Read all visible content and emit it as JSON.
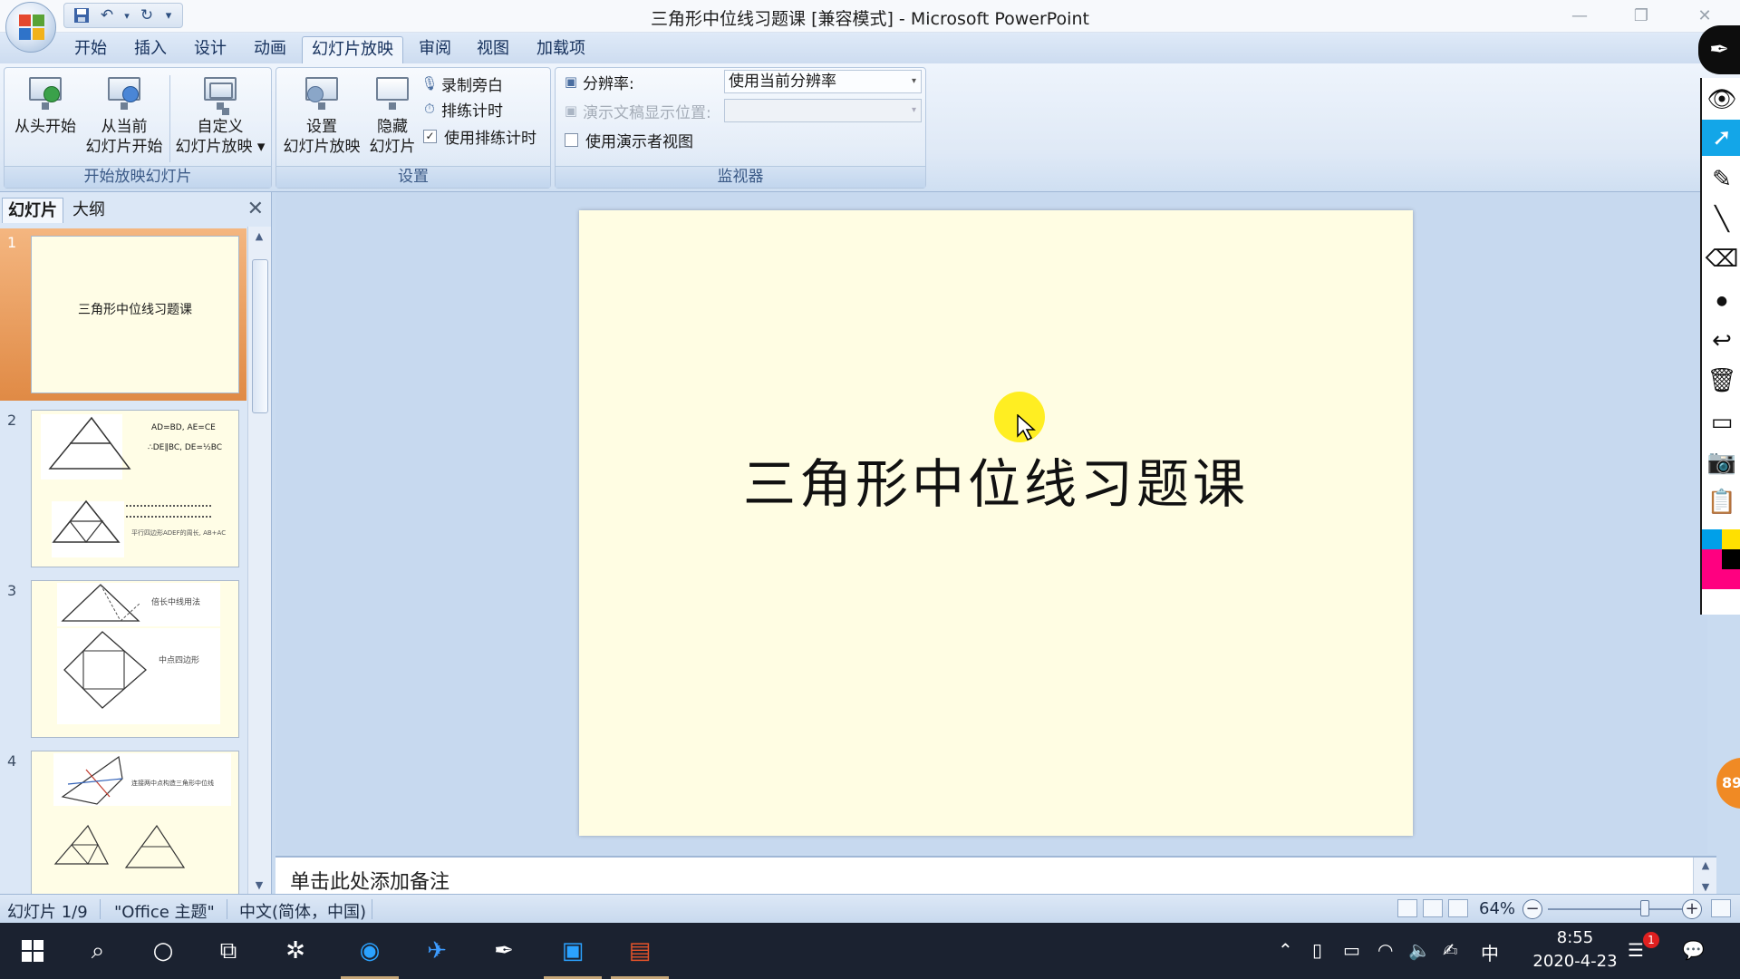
{
  "window": {
    "title": "三角形中位线习题课 [兼容模式] - Microsoft PowerPoint",
    "minimize": "—",
    "restore": "❐",
    "close": "✕"
  },
  "qat": {
    "save_icon": "save-icon",
    "undo_icon": "undo-icon",
    "redo_icon": "redo-icon",
    "more": "▾"
  },
  "tabs": [
    "开始",
    "插入",
    "设计",
    "动画",
    "幻灯片放映",
    "审阅",
    "视图",
    "加载项"
  ],
  "active_tab": "幻灯片放映",
  "ribbon": {
    "start_group": {
      "label": "开始放映幻灯片",
      "from_start": "从头开始",
      "from_current_1": "从当前",
      "from_current_2": "幻灯片开始",
      "custom_1": "自定义",
      "custom_2": "幻灯片放映 ▾"
    },
    "setup_group": {
      "label": "设置",
      "setup_1": "设置",
      "setup_2": "幻灯片放映",
      "hide_1": "隐藏",
      "hide_2": "幻灯片",
      "record": "录制旁白",
      "rehearse": "排练计时",
      "use_timings": "使用排练计时",
      "use_timings_checked": true
    },
    "monitor_group": {
      "label": "监视器",
      "resolution_label": "分辨率:",
      "resolution_value": "使用当前分辨率",
      "show_on_label": "演示文稿显示位置:",
      "show_on_value": "",
      "presenter_view": "使用演示者视图",
      "presenter_view_checked": false
    }
  },
  "slide_panel": {
    "tab_slides": "幻灯片",
    "tab_outline": "大纲",
    "close": "✕",
    "slides": [
      {
        "num": "1",
        "title": "三角形中位线习题课"
      },
      {
        "num": "2",
        "text_a": "AD=BD, AE=CE",
        "text_b": "∴DE∥BC, DE=½BC",
        "text_c": "平行四边形ADEF的周长, AB+AC"
      },
      {
        "num": "3",
        "text_a": "倍长中线用法",
        "text_b": "中点四边形"
      },
      {
        "num": "4",
        "text_a": "连接两中点构造三角形中位线"
      }
    ]
  },
  "slide": {
    "title": "三角形中位线习题课"
  },
  "notes": {
    "placeholder": "单击此处添加备注"
  },
  "status": {
    "slide_info": "幻灯片 1/9",
    "theme": "\"Office 主题\"",
    "language": "中文(简体，中国)",
    "zoom": "64%",
    "zoom_fraction": 0.18
  },
  "pen_tools": [
    "eye-icon",
    "pointer-icon",
    "highlighter-icon",
    "line-icon",
    "eraser-icon",
    "dot-icon",
    "undo-icon",
    "trash-icon",
    "board-icon",
    "camera-icon",
    "clipboard-icon"
  ],
  "pen_colors": [
    "#00a0e9",
    "#ffe000",
    "#ff0080",
    "#000000"
  ],
  "orange_badge": "89",
  "taskbar": {
    "time": "8:55",
    "date": "2020-4-23",
    "ime": "中",
    "notifications": "1"
  },
  "colors": {
    "slide_bg": "#fffde3",
    "accent_blue": "#13a6e8",
    "selected_thumb": "#e08a45"
  }
}
